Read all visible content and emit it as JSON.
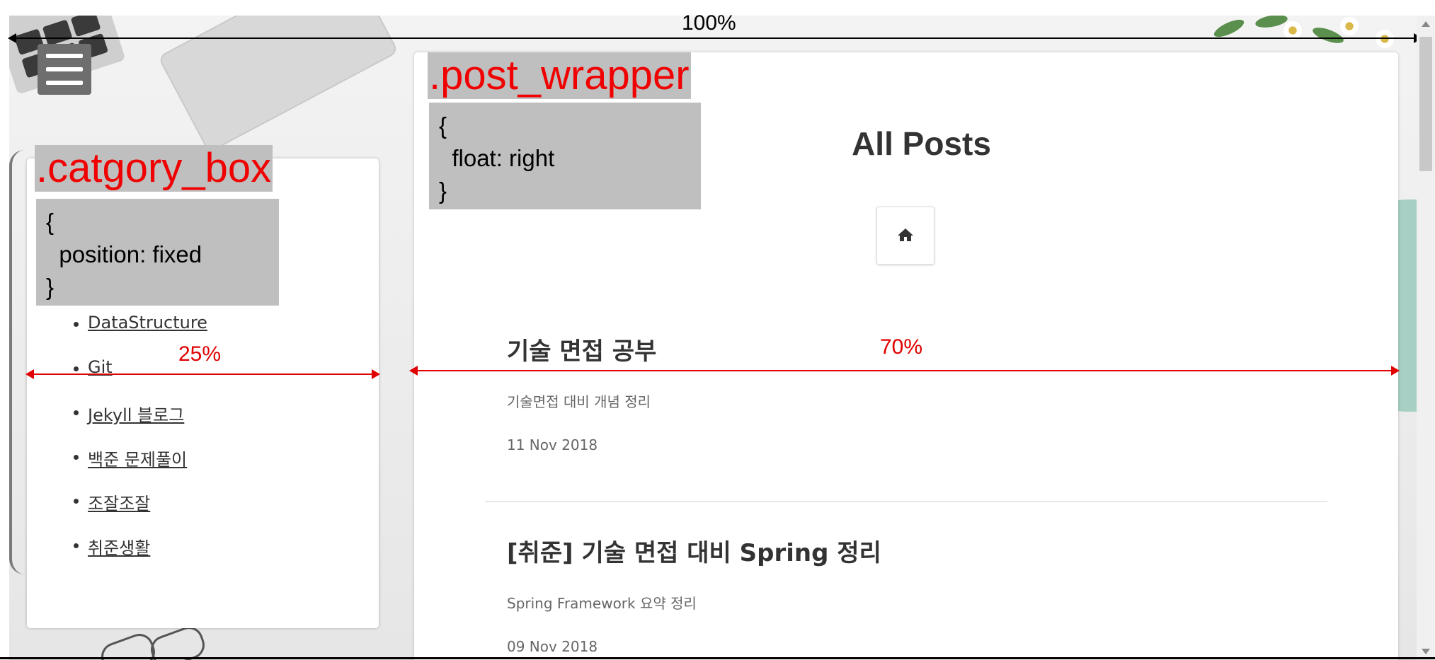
{
  "annotations": {
    "full_width_label": "100%",
    "category_width_label": "25%",
    "post_width_label": "70%",
    "category_box": {
      "selector": ".catgory_box",
      "rule": "{\n  position: fixed\n}"
    },
    "post_wrapper": {
      "selector": ".post_wrapper",
      "rule": "{\n  float: right\n}"
    }
  },
  "menu": {
    "icon": "hamburger-menu-icon"
  },
  "categories": {
    "items": [
      {
        "label": "DataStructure"
      },
      {
        "label": "Git"
      },
      {
        "label": "Jekyll 블로그"
      },
      {
        "label": "백준 문제풀이"
      },
      {
        "label": "조잘조잘"
      },
      {
        "label": "취준생활"
      }
    ]
  },
  "main": {
    "title": "All Posts",
    "home_icon": "home-icon",
    "posts": [
      {
        "title": "기술 면접 공부",
        "description": "기술면접 대비 개념 정리",
        "date": "11 Nov 2018"
      },
      {
        "title": "[취준] 기술 면접 대비 Spring 정리",
        "description": "Spring Framework 요약 정리",
        "date": "09 Nov 2018"
      }
    ]
  },
  "colors": {
    "annotation_red": "#e00000",
    "annotation_box": "#bfbfbf",
    "text": "#333333"
  }
}
